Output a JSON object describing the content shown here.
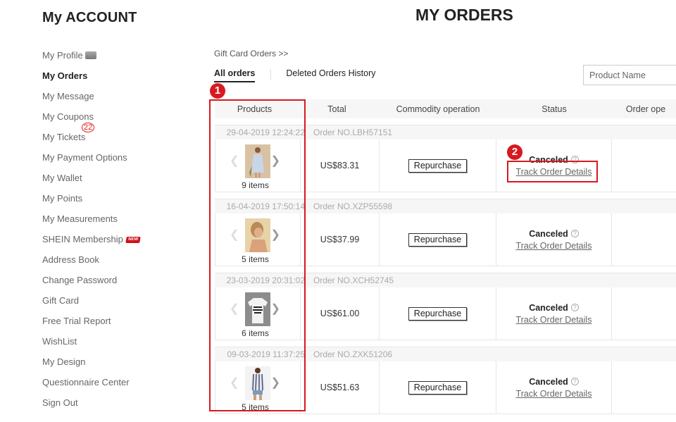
{
  "header": {
    "account_title": "My ACCOUNT",
    "page_title": "MY ORDERS"
  },
  "sidebar": {
    "items": [
      {
        "label": "My Profile",
        "icon": "profile-envelope-icon"
      },
      {
        "label": "My Orders",
        "active": true
      },
      {
        "label": "My Message"
      },
      {
        "label": "My Coupons"
      },
      {
        "label": "My Tickets",
        "badge": "22"
      },
      {
        "label": "My Payment Options"
      },
      {
        "label": "My Wallet"
      },
      {
        "label": "My Points"
      },
      {
        "label": "My Measurements"
      },
      {
        "label": "SHEIN Membership",
        "badge": "NEW"
      },
      {
        "label": "Address Book"
      },
      {
        "label": "Change Password"
      },
      {
        "label": "Gift Card"
      },
      {
        "label": "Free Trial Report"
      },
      {
        "label": "WishList"
      },
      {
        "label": "My Design"
      },
      {
        "label": "Questionnaire Center"
      },
      {
        "label": "Sign Out"
      }
    ]
  },
  "main": {
    "breadcrumb": "Gift Card Orders >>",
    "tabs": [
      {
        "label": "All orders",
        "active": true
      },
      {
        "label": "Deleted Orders History"
      }
    ],
    "search": {
      "placeholder": "Product Name",
      "value": ""
    },
    "table": {
      "columns": [
        "Products",
        "Total",
        "Commodity operation",
        "Status",
        "Order ope"
      ],
      "orders": [
        {
          "date": "29-04-2019 12:24:22",
          "order_no": "Order NO.LBH57151",
          "items": "9 items",
          "total": "US$83.31",
          "action": "Repurchase",
          "status": "Canceled",
          "track": "Track Order Details",
          "image": "light-blue-dress"
        },
        {
          "date": "16-04-2019 17:50:14",
          "order_no": "Order NO.XZP55598",
          "items": "5 items",
          "total": "US$37.99",
          "action": "Repurchase",
          "status": "Canceled",
          "track": "Track Order Details",
          "image": "model-portrait"
        },
        {
          "date": "23-03-2019 20:31:02",
          "order_no": "Order NO.XCH52745",
          "items": "6 items",
          "total": "US$61.00",
          "action": "Repurchase",
          "status": "Canceled",
          "track": "Track Order Details",
          "image": "white-graphic-tee"
        },
        {
          "date": "09-03-2019 11:37:25",
          "order_no": "Order NO.ZXK51206",
          "items": "5 items",
          "total": "US$51.63",
          "action": "Repurchase",
          "status": "Canceled",
          "track": "Track Order Details",
          "image": "striped-blouse"
        }
      ]
    }
  },
  "annotations": [
    {
      "number": "1",
      "target": "products-column"
    },
    {
      "number": "2",
      "target": "track-order-details-link"
    }
  ],
  "colors": {
    "annotation": "#d71920",
    "header_bg": "#f6f6f6"
  }
}
